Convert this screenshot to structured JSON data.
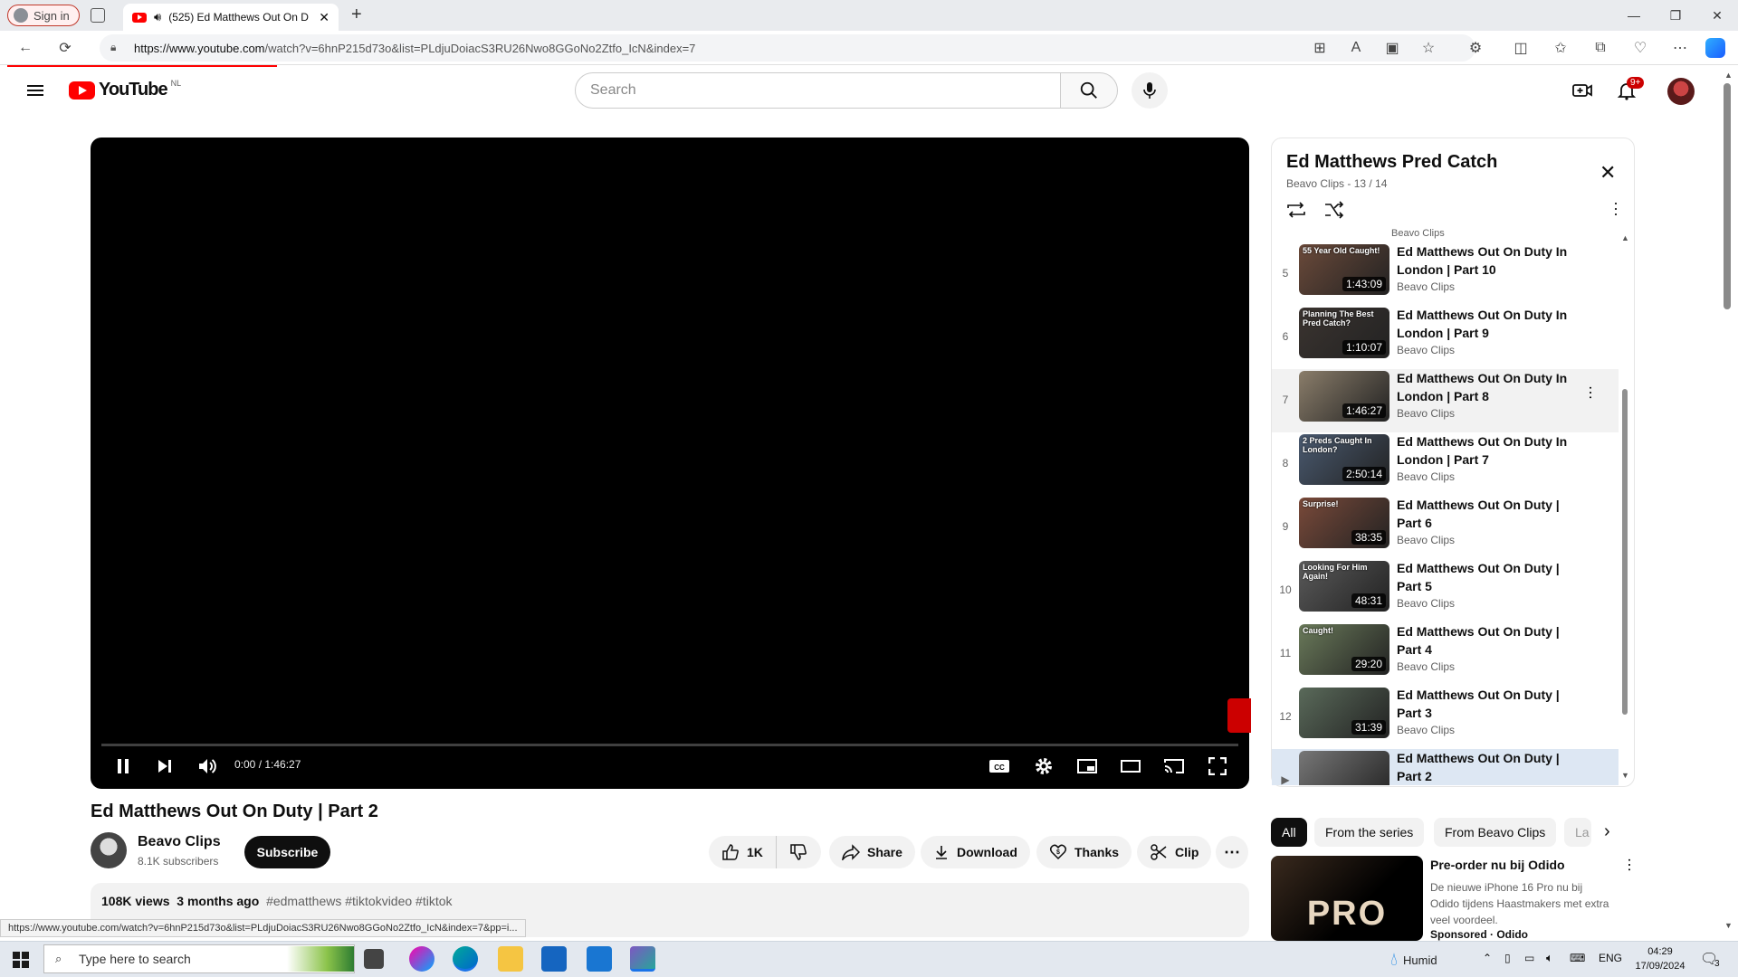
{
  "browser": {
    "signin_label": "Sign in",
    "tab_title": "(525) Ed Matthews Out On D",
    "url_host": "https://www.youtube.com",
    "url_path": "/watch?v=6hnP215d73o&list=PLdjuDoiacS3RU26Nwo8GGoNo2Ztfo_IcN&index=7",
    "status_url": "https://www.youtube.com/watch?v=6hnP215d73o&list=PLdjuDoiacS3RU26Nwo8GGoNo2Ztfo_IcN&index=7&pp=i..."
  },
  "header": {
    "logo_text": "YouTube",
    "country_code": "NL",
    "search_placeholder": "Search",
    "notifications_badge": "9+"
  },
  "player": {
    "time_display": "0:00 / 1:46:27",
    "progress_fraction": 0.0
  },
  "video": {
    "title": "Ed Matthews Out On Duty | Part 2",
    "channel": "Beavo Clips",
    "subscribers": "8.1K subscribers",
    "subscribe_label": "Subscribe",
    "likes": "1K",
    "share_label": "Share",
    "download_label": "Download",
    "thanks_label": "Thanks",
    "clip_label": "Clip",
    "views": "108K views",
    "age": "3 months ago",
    "hashtags": "#edmatthews #tiktokvideo #tiktok"
  },
  "playlist": {
    "title": "Ed Matthews Pred Catch",
    "subtitle": "Beavo Clips - 13 / 14",
    "top_partial_channel": "Beavo Clips",
    "items": [
      {
        "index": "5",
        "title": "Ed Matthews Out On Duty In London | Part 10",
        "channel": "Beavo Clips",
        "duration": "1:43:09",
        "caption": "55 Year Old Caught!",
        "color": "#6b4a3a"
      },
      {
        "index": "6",
        "title": "Ed Matthews Out On Duty In London | Part 9",
        "channel": "Beavo Clips",
        "duration": "1:10:07",
        "caption": "Planning The Best Pred Catch?",
        "color": "#3b3430"
      },
      {
        "index": "7",
        "title": "Ed Matthews Out On Duty In London | Part 8",
        "channel": "Beavo Clips",
        "duration": "1:46:27",
        "caption": "",
        "color": "#8a7d6a"
      },
      {
        "index": "8",
        "title": "Ed Matthews Out On Duty In London | Part 7",
        "channel": "Beavo Clips",
        "duration": "2:50:14",
        "caption": "2 Preds Caught In London?",
        "color": "#4a5a70"
      },
      {
        "index": "9",
        "title": "Ed Matthews Out On Duty | Part 6",
        "channel": "Beavo Clips",
        "duration": "38:35",
        "caption": "Surprise!",
        "color": "#7a4a3a"
      },
      {
        "index": "10",
        "title": "Ed Matthews Out On Duty | Part 5",
        "channel": "Beavo Clips",
        "duration": "48:31",
        "caption": "Looking For Him Again!",
        "color": "#5a5a5a"
      },
      {
        "index": "11",
        "title": "Ed Matthews Out On Duty | Part 4",
        "channel": "Beavo Clips",
        "duration": "29:20",
        "caption": "Caught!",
        "color": "#6a7a5a"
      },
      {
        "index": "12",
        "title": "Ed Matthews Out On Duty | Part 3",
        "channel": "Beavo Clips",
        "duration": "31:39",
        "caption": "",
        "color": "#5a6a5a"
      },
      {
        "index": "▶",
        "title": "Ed Matthews Out On Duty | Part 2",
        "channel": "",
        "duration": "",
        "caption": "",
        "color": "#777"
      }
    ]
  },
  "chips": [
    "All",
    "From the series",
    "From Beavo Clips",
    "La"
  ],
  "ad": {
    "thumb_text": "PRO",
    "title": "Pre-order nu bij Odido",
    "description": "De nieuwe iPhone 16 Pro nu bij Odido tijdens Haastmakers met extra veel voordeel.",
    "sponsor": "Sponsored · Odido"
  },
  "taskbar": {
    "search_placeholder": "Type here to search",
    "weather": "Humid",
    "lang": "ENG",
    "time": "04:29",
    "date": "17/09/2024",
    "notif_count": "3"
  }
}
